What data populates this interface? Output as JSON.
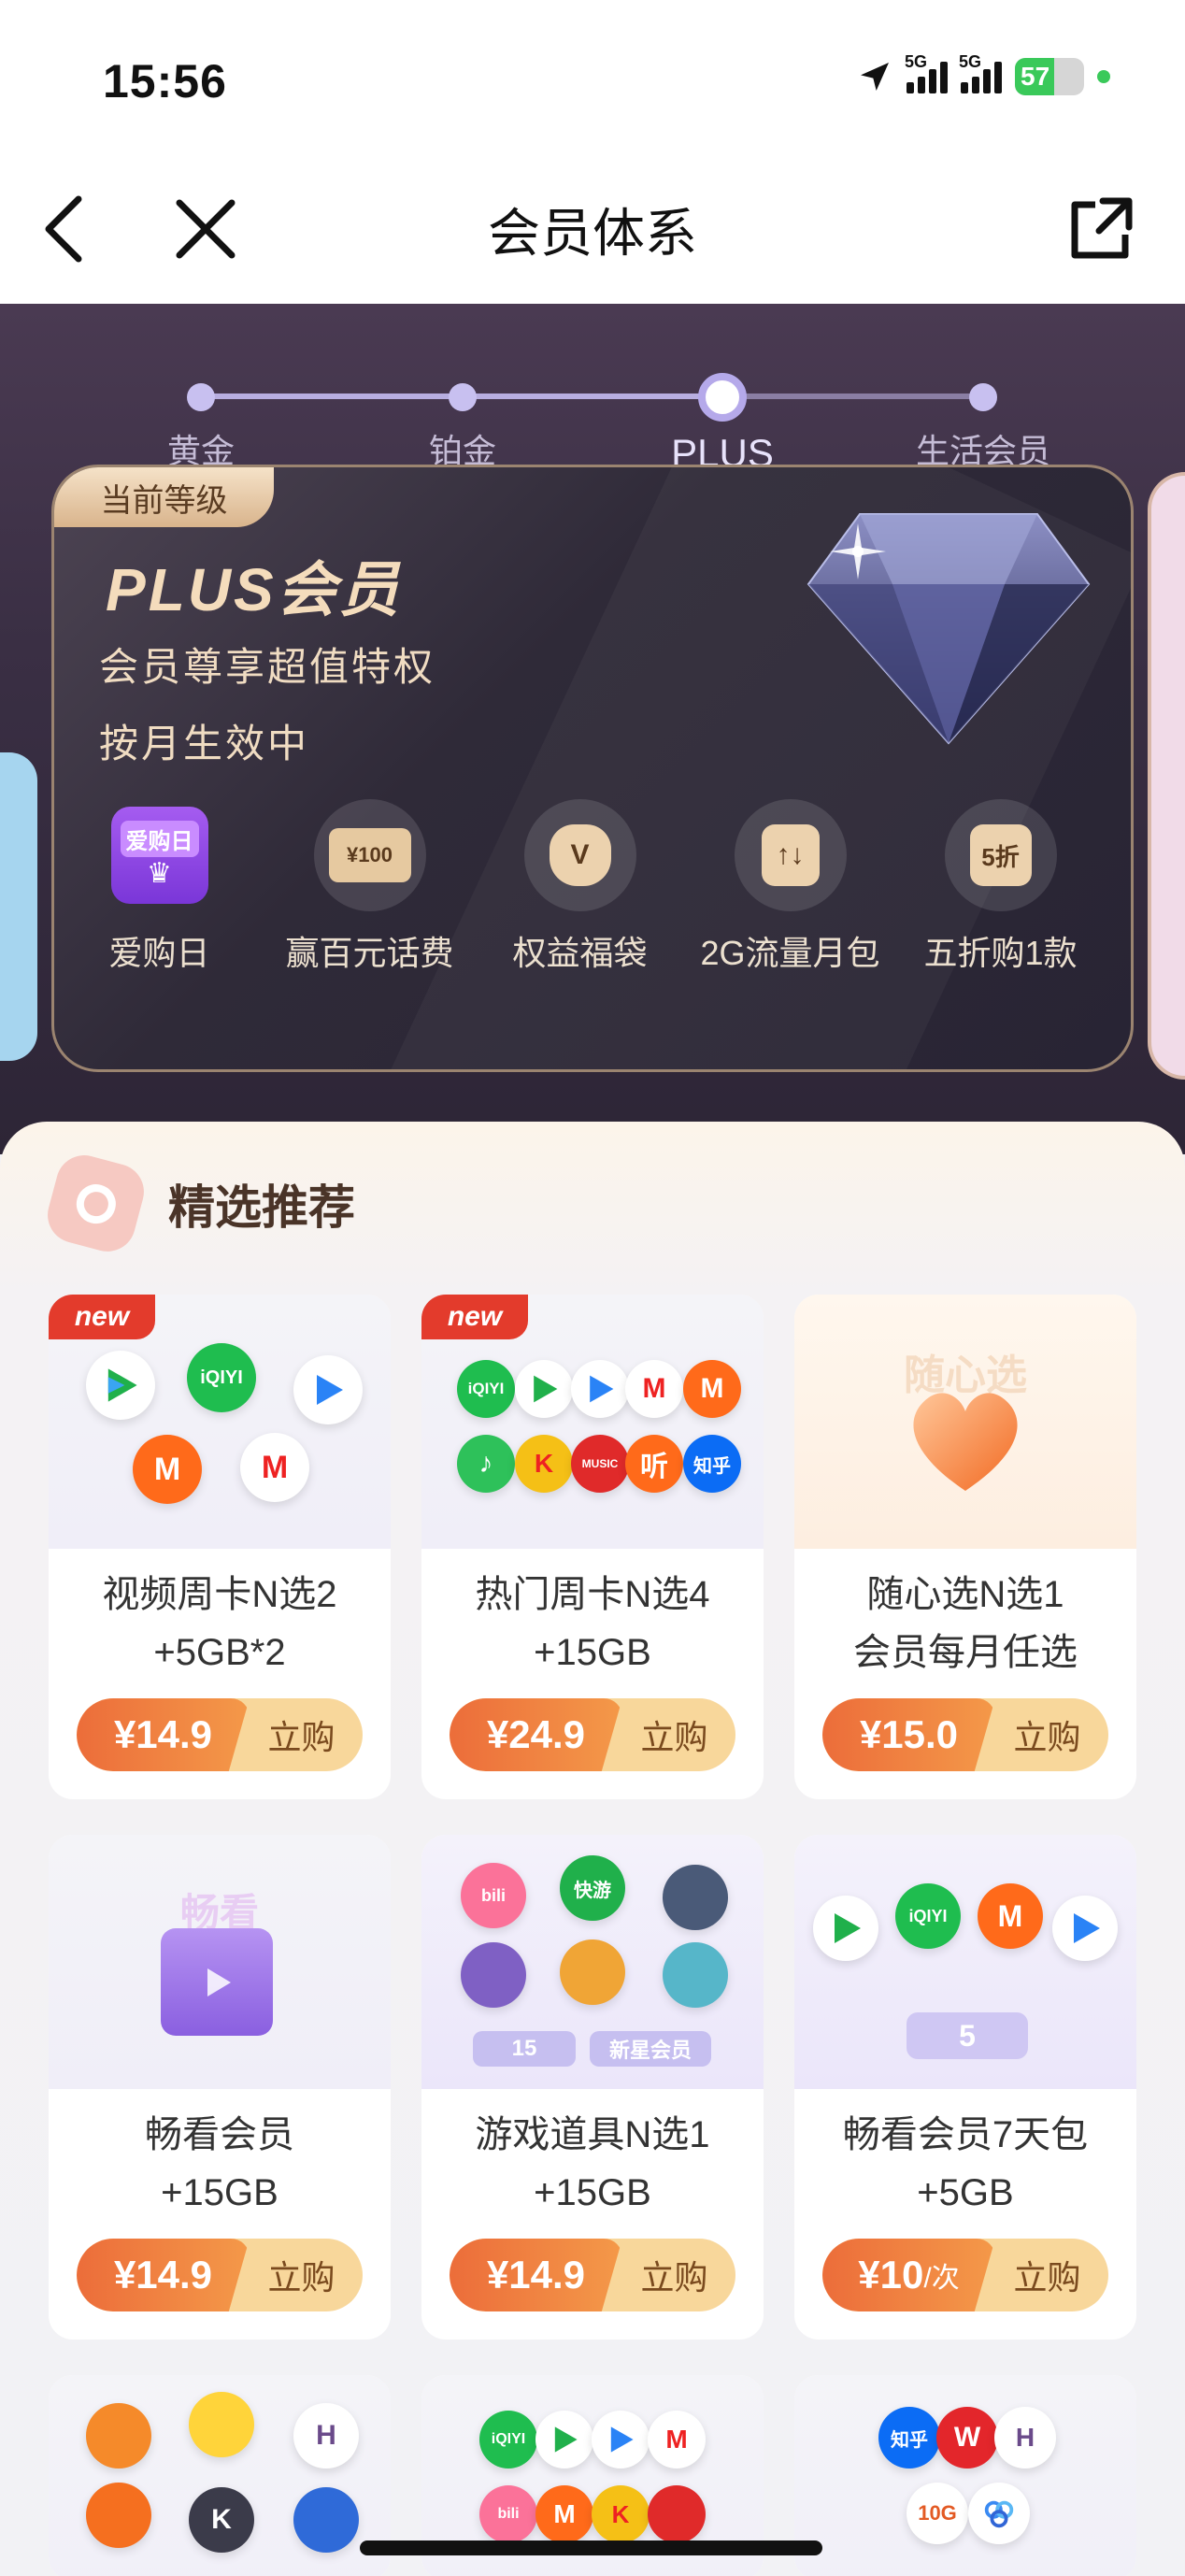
{
  "status_bar": {
    "time": "15:56",
    "net1": "5G",
    "net2": "5G",
    "battery": "57"
  },
  "nav": {
    "title": "会员体系"
  },
  "levels": [
    {
      "name": "黄金",
      "current": false
    },
    {
      "name": "铂金",
      "current": false
    },
    {
      "name": "PLUS",
      "current": true
    },
    {
      "name": "生活会员",
      "current": false
    }
  ],
  "member_card": {
    "tag": "当前等级",
    "title": "PLUS会员",
    "desc1": "会员尊享超值特权",
    "desc2": "按月生效中",
    "perks": [
      {
        "label": "爱购日",
        "icon": "love-shopping-day-icon",
        "icon_text": "爱购日"
      },
      {
        "label": "赢百元话费",
        "icon": "phone-bill-coupon-icon",
        "icon_text": "¥100"
      },
      {
        "label": "权益福袋",
        "icon": "lucky-bag-icon",
        "icon_text": "V"
      },
      {
        "label": "2G流量月包",
        "icon": "data-package-icon",
        "icon_text": "↑↓"
      },
      {
        "label": "五折购1款",
        "icon": "half-price-icon",
        "icon_text": "5折"
      }
    ]
  },
  "recommend": {
    "title": "精选推荐",
    "new_label": "new",
    "buy_label": "立购",
    "products": [
      {
        "line1": "视频周卡N选2",
        "line2": "+5GB*2",
        "price": "¥14.9",
        "unit": "",
        "is_new": true
      },
      {
        "line1": "热门周卡N选4",
        "line2": "+15GB",
        "price": "¥24.9",
        "unit": "",
        "is_new": true
      },
      {
        "line1": "随心选N选1",
        "line2": "会员每月任选",
        "price": "¥15.0",
        "unit": "",
        "is_new": false,
        "img_text": "随心选"
      },
      {
        "line1": "畅看会员",
        "line2": "+15GB",
        "price": "¥14.9",
        "unit": "",
        "is_new": false,
        "img_text": "畅看"
      },
      {
        "line1": "游戏道具N选1",
        "line2": "+15GB",
        "price": "¥14.9",
        "unit": "",
        "is_new": false,
        "img_badges": [
          "15",
          "新星会员"
        ]
      },
      {
        "line1": "畅看会员7天包",
        "line2": "+5GB",
        "price": "¥10",
        "unit": "/次",
        "is_new": false,
        "img_badge": "5"
      }
    ]
  },
  "app_logos": {
    "iqiyi": "iQIYI",
    "zhihu": "知乎",
    "ting": "听",
    "music": "MUSIC",
    "kuaiyou": "快游",
    "bili": "bili",
    "k": "K",
    "h": "H"
  },
  "colors": {
    "accent_orange": "#ec6d3a",
    "gold_text": "#f4dcbc",
    "hero_bg": "#3a2f44",
    "new_red": "#e33b2c"
  }
}
